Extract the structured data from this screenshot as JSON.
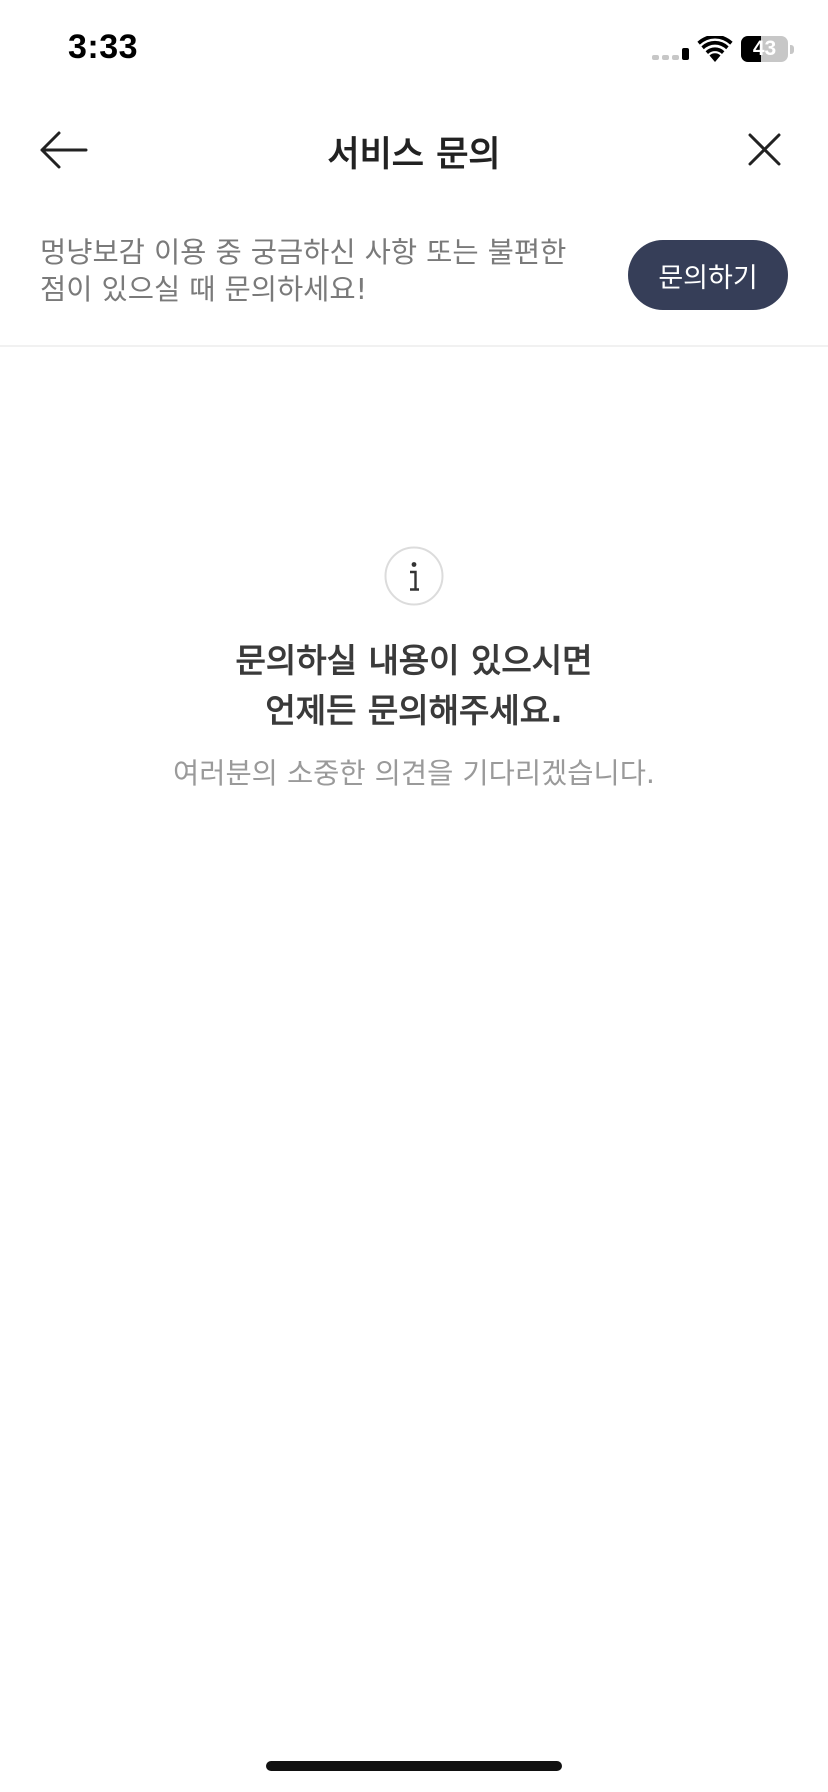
{
  "status_bar": {
    "time": "3:33",
    "battery_level": "43",
    "battery_fraction": 0.43,
    "signal_bars_active": 1,
    "icons": [
      "cellular-signal-icon",
      "wifi-icon",
      "battery-icon"
    ]
  },
  "nav": {
    "title": "서비스 문의",
    "back_icon": "arrow-left-icon",
    "close_icon": "close-icon"
  },
  "banner": {
    "text": "멍냥보감 이용 중 궁금하신 사항 또는 불편한\n점이 있으실 때 문의하세요!",
    "button_label": "문의하기",
    "button_color": "#363e58"
  },
  "empty_state": {
    "icon": "info-icon",
    "title": "문의하실 내용이 있으시면\n언제든 문의해주세요.",
    "subtitle": "여러분의 소중한 의견을 기다리겠습니다."
  }
}
